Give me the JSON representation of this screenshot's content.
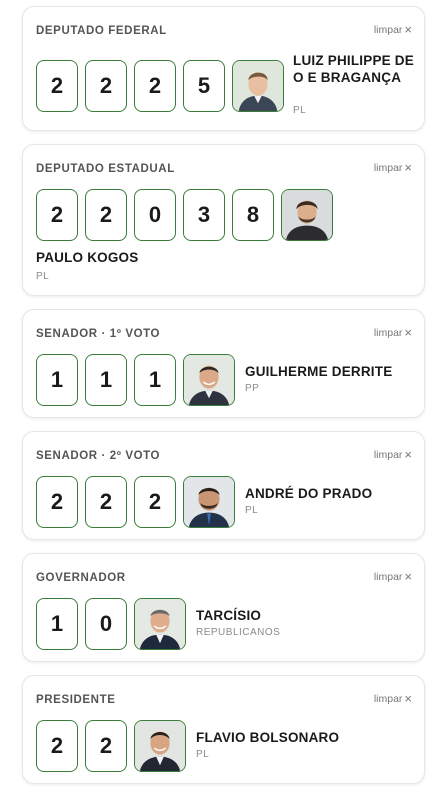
{
  "clear_label": "limpar",
  "accent_color": "#3a7d3a",
  "cards": [
    {
      "role": "DEPUTADO FEDERAL",
      "digits": [
        "2",
        "2",
        "2",
        "5"
      ],
      "name": "LUIZ PHILIPPE DE O E BRAGANÇA",
      "party": "PL"
    },
    {
      "role": "DEPUTADO ESTADUAL",
      "digits": [
        "2",
        "2",
        "0",
        "3",
        "8"
      ],
      "name": "PAULO KOGOS",
      "party": "PL"
    },
    {
      "role": "SENADOR · 1º VOTO",
      "digits": [
        "1",
        "1",
        "1"
      ],
      "name": "GUILHERME DERRITE",
      "party": "PP"
    },
    {
      "role": "SENADOR · 2º VOTO",
      "digits": [
        "2",
        "2",
        "2"
      ],
      "name": "ANDRÉ DO PRADO",
      "party": "PL"
    },
    {
      "role": "GOVERNADOR",
      "digits": [
        "1",
        "0"
      ],
      "name": "TARCÍSIO",
      "party": "REPUBLICANOS"
    },
    {
      "role": "PRESIDENTE",
      "digits": [
        "2",
        "2"
      ],
      "name": "FLAVIO BOLSONARO",
      "party": "PL"
    }
  ]
}
